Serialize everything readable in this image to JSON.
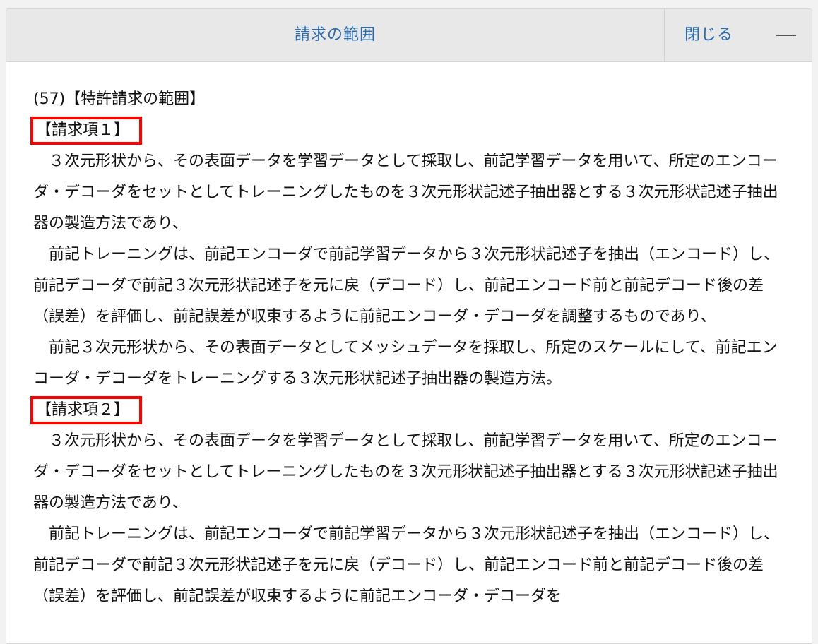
{
  "header": {
    "title": "請求の範囲",
    "close_label": "閉じる"
  },
  "content": {
    "section_heading": "(57)【特許請求の範囲】",
    "claims": [
      {
        "label": "【請求項１】",
        "paragraphs": [
          "３次元形状から、その表面データを学習データとして採取し、前記学習データを用いて、所定のエンコーダ・デコーダをセットとしてトレーニングしたものを３次元形状記述子抽出器とする３次元形状記述子抽出器の製造方法であり、",
          "前記トレーニングは、前記エンコーダで前記学習データから３次元形状記述子を抽出（エンコード）し、前記デコーダで前記３次元形状記述子を元に戻（デコード）し、前記エンコード前と前記デコード後の差（誤差）を評価し、前記誤差が収束するように前記エンコーダ・デコーダを調整するものであり、",
          "前記３次元形状から、その表面データとしてメッシュデータを採取し、所定のスケールにして、前記エンコーダ・デコーダをトレーニングする３次元形状記述子抽出器の製造方法。"
        ]
      },
      {
        "label": "【請求項２】",
        "paragraphs": [
          "３次元形状から、その表面データを学習データとして採取し、前記学習データを用いて、所定のエンコーダ・デコーダをセットとしてトレーニングしたものを３次元形状記述子抽出器とする３次元形状記述子抽出器の製造方法であり、",
          "前記トレーニングは、前記エンコーダで前記学習データから３次元形状記述子を抽出（エンコード）し、前記デコーダで前記３次元形状記述子を元に戻（デコード）し、前記エンコード前と前記デコード後の差（誤差）を評価し、前記誤差が収束するように前記エンコーダ・デコーダを"
        ]
      }
    ]
  },
  "colors": {
    "accent": "#2b6cb0",
    "highlight_border": "#ff0000"
  }
}
